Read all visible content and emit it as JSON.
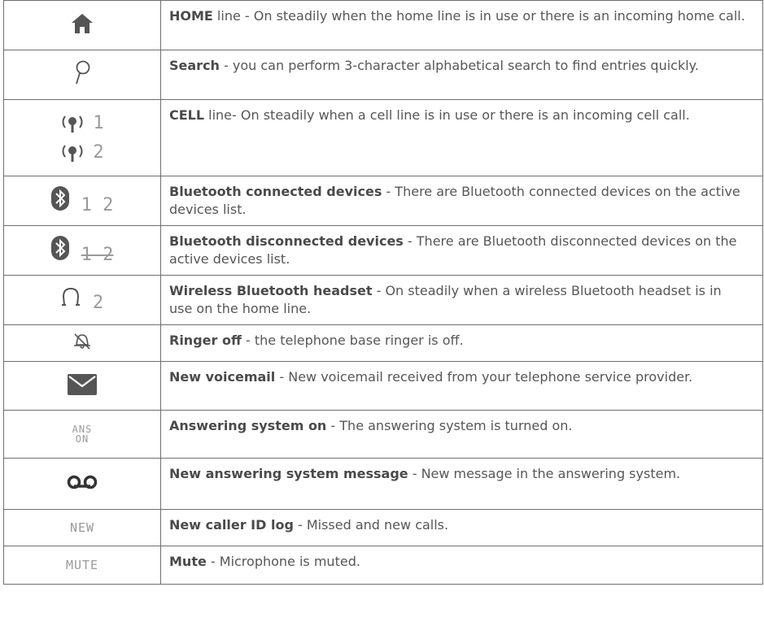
{
  "rows": [
    {
      "icon": "home-icon",
      "title": "HOME",
      "desc": " line - On steadily when the home line is in use or there is an incoming home call."
    },
    {
      "icon": "search-icon",
      "title": "Search",
      "desc": " - you can perform 3-character alphabetical search to find entries quickly."
    },
    {
      "icon": "cell-line-icon",
      "title": "CELL",
      "desc": " line- On steadily when a cell line is in use or there is an incoming cell call.",
      "digits": [
        "1",
        "2"
      ]
    },
    {
      "icon": "bluetooth-connected-icon",
      "title": "Bluetooth connected devices",
      "desc": " - There are Bluetooth connected devices on the active devices list.",
      "digits": "1 2"
    },
    {
      "icon": "bluetooth-disconnected-icon",
      "title": "Bluetooth disconnected devices",
      "desc": " - There are Bluetooth disconnected devices on the active devices list.",
      "digits": "1 2"
    },
    {
      "icon": "headset-icon",
      "title": "Wireless Bluetooth headset",
      "desc": " - On steadily when a wireless Bluetooth headset is in use on the home line.",
      "digits": "2"
    },
    {
      "icon": "ringer-off-icon",
      "title": "Ringer off",
      "desc": " - the telephone base ringer is off."
    },
    {
      "icon": "voicemail-envelope-icon",
      "title": "New voicemail",
      "desc": " - New voicemail received from your telephone service provider."
    },
    {
      "icon": "answering-system-icon",
      "title": "Answering system on",
      "desc": " - The answering system is turned on.",
      "lcd": [
        "ANS",
        "ON"
      ]
    },
    {
      "icon": "message-tape-icon",
      "title": "New answering system message",
      "desc": " - New message in the answering system."
    },
    {
      "icon": "new-calls-icon",
      "title": "New caller ID log",
      "desc": " - Missed and new calls.",
      "lcd": [
        "NEW"
      ]
    },
    {
      "icon": "mute-icon",
      "title": "Mute",
      "desc": " - Microphone is muted.",
      "lcd": [
        "MUTE"
      ]
    }
  ]
}
